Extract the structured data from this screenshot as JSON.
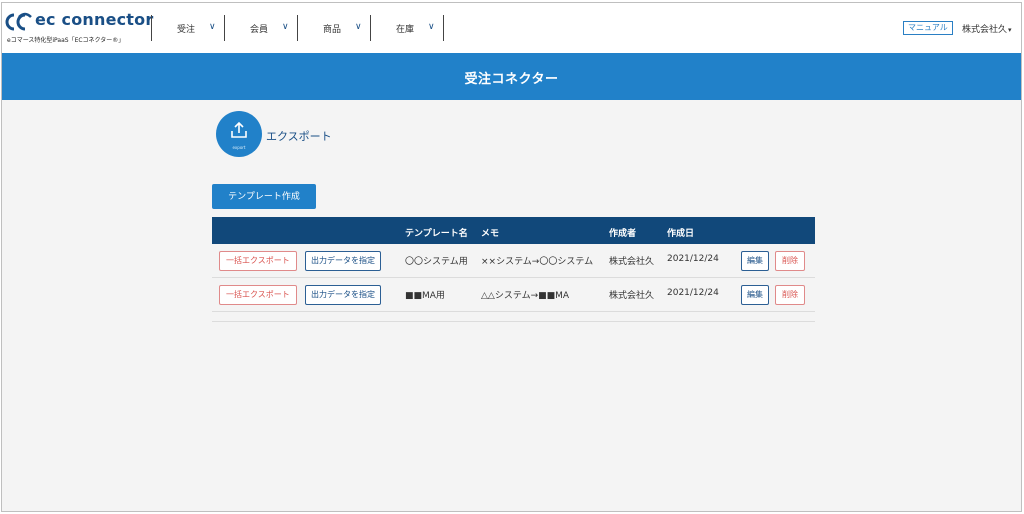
{
  "header": {
    "logo_text": "ec connector",
    "logo_sub": "eコマース特化型iPaaS「ECコネクター®」",
    "nav": [
      {
        "label": "受注",
        "chevron": "∨"
      },
      {
        "label": "会員",
        "chevron": "∨"
      },
      {
        "label": "商品",
        "chevron": "∨"
      },
      {
        "label": "在庫",
        "chevron": "∨"
      }
    ],
    "manual_label": "マニュアル",
    "company_label": "株式会社久",
    "company_caret": "▾"
  },
  "banner": {
    "title": "受注コネクター"
  },
  "export": {
    "icon": "export-upload-icon",
    "mini_label": "export",
    "label": "エクスポート"
  },
  "create_button": "テンプレート作成",
  "table": {
    "headers": {
      "template_name": "テンプレート名",
      "memo": "メモ",
      "creator": "作成者",
      "created_date": "作成日"
    },
    "rows": [
      {
        "bulk_export": "一括エクスポート",
        "specify_output": "出力データを指定",
        "template_name": "〇〇システム用",
        "memo": "××システム→〇〇システム",
        "creator": "株式会社久",
        "created_date": "2021/12/24",
        "edit": "編集",
        "delete": "削除"
      },
      {
        "bulk_export": "一括エクスポート",
        "specify_output": "出力データを指定",
        "template_name": "■■MA用",
        "memo": "△△システム→■■MA",
        "creator": "株式会社久",
        "created_date": "2021/12/24",
        "edit": "編集",
        "delete": "削除"
      }
    ]
  },
  "colors": {
    "brand_blue": "#2181c9",
    "header_dark": "#11487a",
    "logo_navy": "#1a4f86",
    "danger": "#d9534f"
  }
}
